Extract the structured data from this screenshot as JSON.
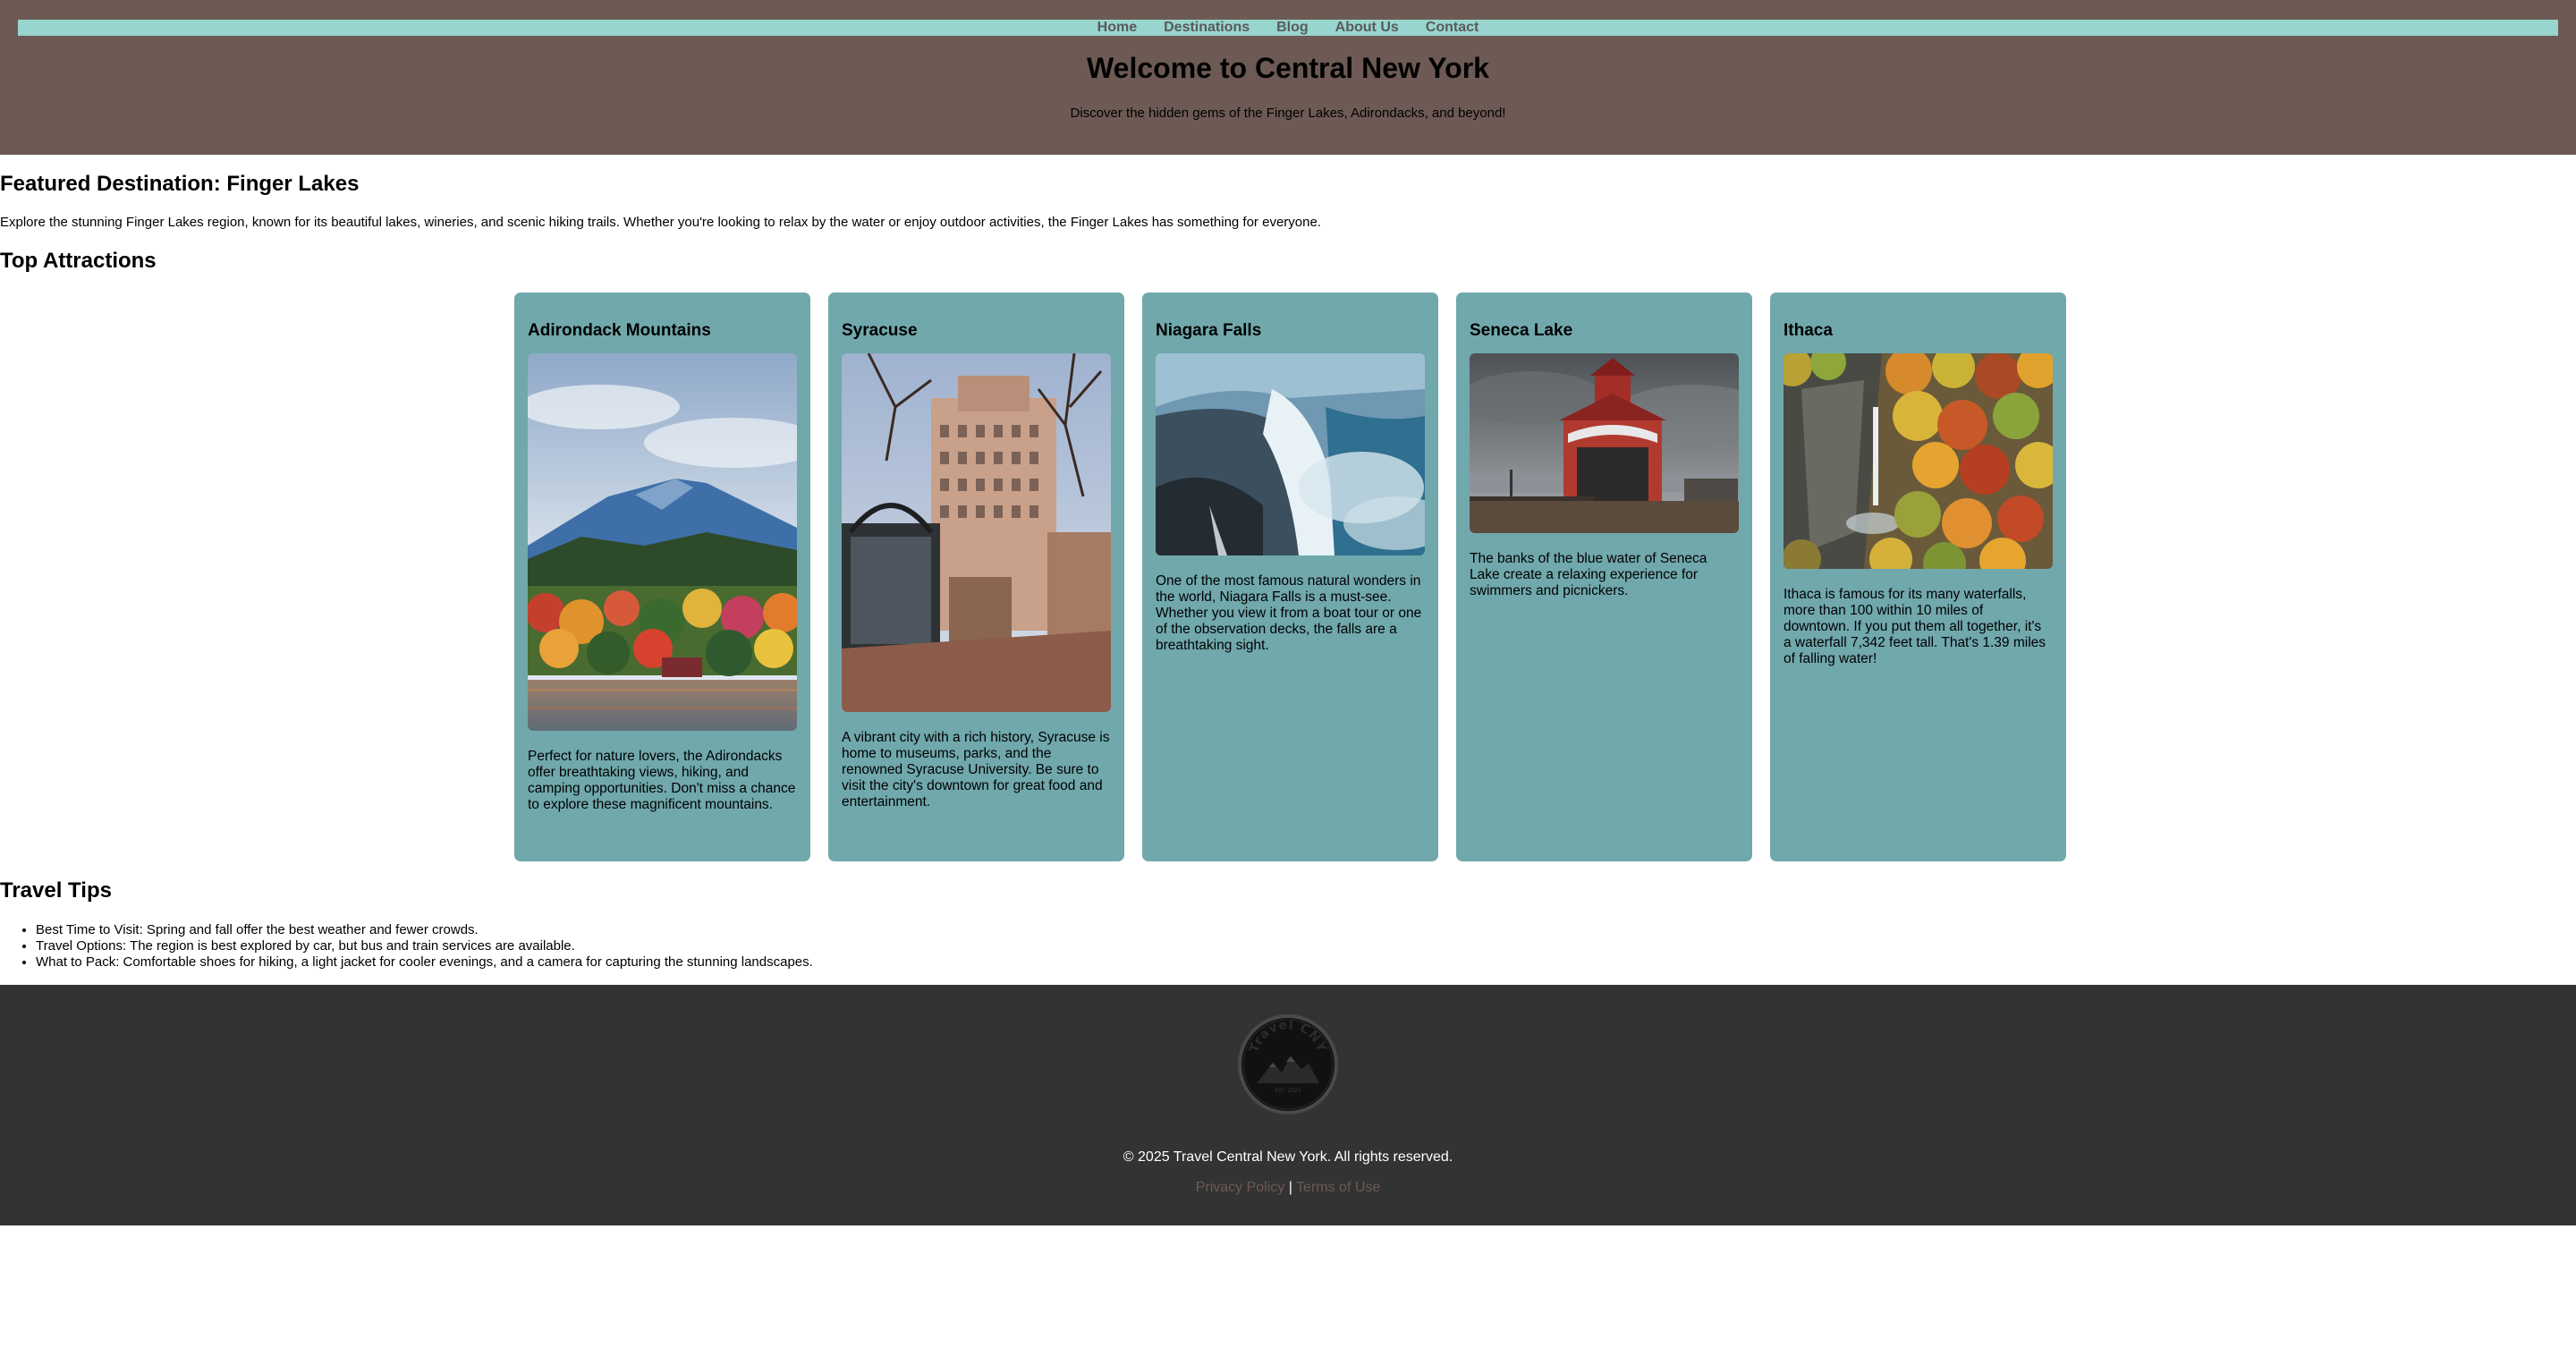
{
  "nav": {
    "items": [
      "Home",
      "Destinations",
      "Blog",
      "About Us",
      "Contact"
    ]
  },
  "header": {
    "title": "Welcome to Central New York",
    "subtitle": "Discover the hidden gems of the Finger Lakes, Adirondacks, and beyond!"
  },
  "featured": {
    "heading": "Featured Destination: Finger Lakes",
    "text": "Explore the stunning Finger Lakes region, known for its beautiful lakes, wineries, and scenic hiking trails. Whether you're looking to relax by the water or enjoy outdoor activities, the Finger Lakes has something for everyone."
  },
  "attractions": {
    "heading": "Top Attractions",
    "cards": [
      {
        "title": "Adirondack Mountains",
        "description": "Perfect for nature lovers, the Adirondacks offer breathtaking views, hiking, and camping opportunities. Don't miss a chance to explore these magnificent mountains."
      },
      {
        "title": "Syracuse",
        "description": "A vibrant city with a rich history, Syracuse is home to museums, parks, and the renowned Syracuse University. Be sure to visit the city's downtown for great food and entertainment."
      },
      {
        "title": "Niagara Falls",
        "description": "One of the most famous natural wonders in the world, Niagara Falls is a must-see. Whether you view it from a boat tour or one of the observation decks, the falls are a breathtaking sight."
      },
      {
        "title": "Seneca Lake",
        "description": "The banks of the blue water of Seneca Lake create a relaxing experience for swimmers and picnickers."
      },
      {
        "title": "Ithaca",
        "description": "Ithaca is famous for its many waterfalls, more than 100 within 10 miles of downtown. If you put them all together, it's a waterfall 7,342 feet tall. That's 1.39 miles of falling water!"
      }
    ]
  },
  "tips": {
    "heading": "Travel Tips",
    "items": [
      "Best Time to Visit: Spring and fall offer the best weather and fewer crowds.",
      "Travel Options: The region is best explored by car, but bus and train services are available.",
      "What to Pack: Comfortable shoes for hiking, a light jacket for cooler evenings, and a camera for capturing the stunning landscapes."
    ]
  },
  "footer": {
    "logo_text": "Travel CNY",
    "logo_small": "EST. 2025",
    "copyright": "© 2025 Travel Central New York. All rights reserved.",
    "privacy": "Privacy Policy",
    "separator": "|",
    "terms": "Terms of Use"
  },
  "colors": {
    "header_bg": "#6d5a54",
    "nav_bg": "#98d5cf",
    "card_bg": "#70a8ac",
    "footer_bg": "#333333"
  }
}
